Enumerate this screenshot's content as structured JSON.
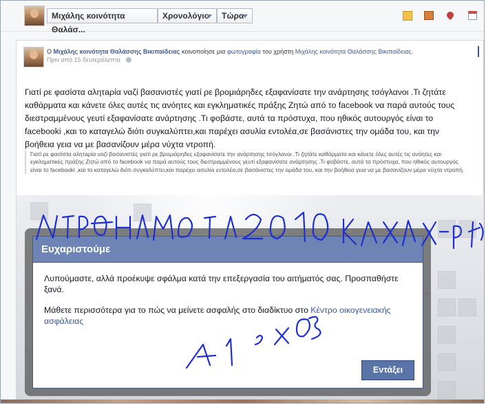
{
  "topbar": {
    "profile_name": "Μιχάλης κοινότητα Θαλάσ...",
    "view_label": "Χρονολόγιο",
    "time_label": "Τώρα",
    "icons": [
      "note-icon",
      "photo-icon",
      "place-icon",
      "event-icon"
    ]
  },
  "story": {
    "prefix": "Ο",
    "actor": "Μιχάλης κοινότητα Θαλάσσης Βικιπαίδειας",
    "action": "κοινοποίησε μια",
    "object": "φωτογραφία",
    "suffix": "του χρήστη",
    "owner": "Μιχάλης κοινότητα Θαλάσσης Βικιπαίδειας.",
    "timestamp": "Πριν από 15 δευτερόλεπτα",
    "body": "Γιατί ρε φασίστα αλητaρία ναζί βασανιστές γιατί ρε βρομιάρηδες εξαφανίσατε την ανάρτησης τσόγλανοι .Τι ζητάτε καθάρματα και κάνετε όλες αυτές τις ανόητες και εγκληματικές πράξης Ζητώ από το facebook να παρά αυτούς τους διεστραμμένους γευτί εξαφανίσατε ανάρτησης .Τι φοβάστε, αυτά τα πρόστυχα, που ηθικός αυτουργός είναι το facebooki ,και το καταγελώ διότι συγκαλύπτει,και παρέχει ασυλία εντολέα,σε βασάνιστες την ομάδα του, και την βοήθεια γεια να με βασανίζουν μέρα νύχτα ντροπή.",
    "quote": "Γιατί ρε φασίστα αλητaρία ναζί βασανιστές γιατί ρε βρομιάρηδες εξαφανίσατε την ανάρτησης τσόγλανοι .Τι ζητάτε καθάρματα και κάνετε όλες αυτές τις ανόητες και εγκληματικές πράξης Ζητώ από το facebook να παρά αυτούς τους διεστραμμένους γευτί εξαφανίσατε ανάρτησης .Τι φοβάστε, αυτά τα πρόστυχα, που ηθικός αυτουργός είναι το facebooki ,και το καταγελώ διότι συγκαλύπτει,και παρέχει ασυλία εντολέα,σε βασάνιστες την ομάδα του, και την βοήθεια γεια να με βασανίζουν μέρα νύχτα ντροπή."
  },
  "dialog": {
    "title": "Ευχαριστούμε",
    "message": "Λυπούμαστε, αλλά προέκυψε σφάλμα κατά την επεξεργασία του αιτήματός σας. Προσπαθήστε ξανά.",
    "learn_more": "Μάθετε περισσότερα για το πώς να μείνετε ασφαλής στο διαδίκτυο στο",
    "link": "Κέντρο οικογενειακής ασφάλειας",
    "ok_label": "Εντάξει"
  },
  "handwriting": {
    "color": "#1d2fd1"
  }
}
